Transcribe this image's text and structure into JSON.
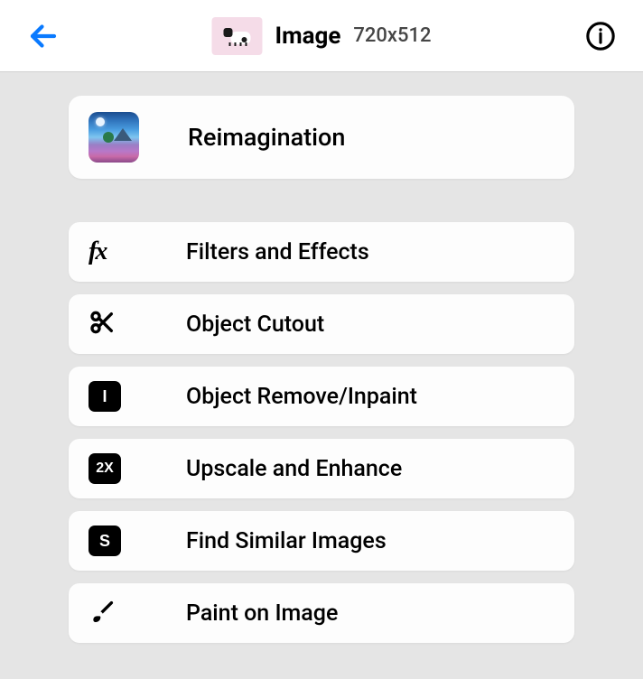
{
  "header": {
    "title": "Image",
    "dimensions": "720x512"
  },
  "featured": {
    "label": "Reimagination"
  },
  "options": [
    {
      "label": "Filters and Effects",
      "icon": "fx"
    },
    {
      "label": "Object Cutout",
      "icon": "scissors"
    },
    {
      "label": "Object Remove/Inpaint",
      "icon": "badge-I"
    },
    {
      "label": "Upscale and Enhance",
      "icon": "badge-2X"
    },
    {
      "label": "Find Similar Images",
      "icon": "badge-S"
    },
    {
      "label": "Paint on Image",
      "icon": "brush"
    }
  ]
}
